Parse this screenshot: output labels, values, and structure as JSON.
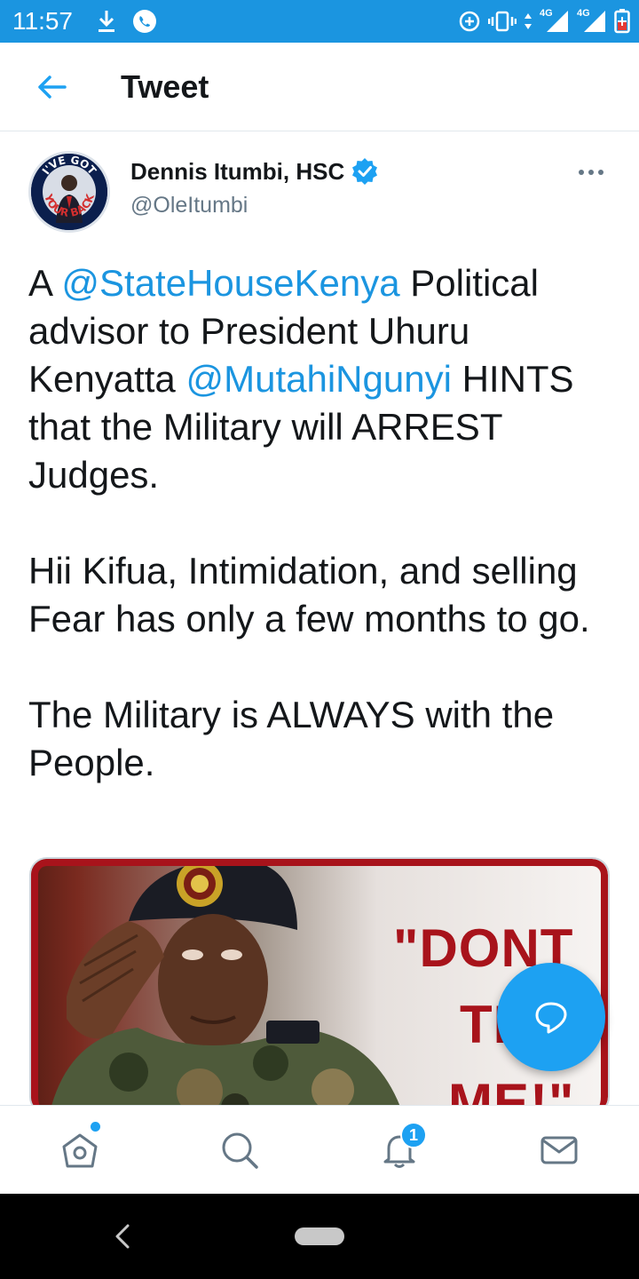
{
  "status_bar": {
    "time": "11:57",
    "network_label_1": "4G",
    "network_label_2": "4G",
    "icons": [
      "download-icon",
      "whatsapp-icon",
      "data-saver-icon",
      "vibrate-icon",
      "signal-4g-icon",
      "signal-4g-icon",
      "battery-icon"
    ]
  },
  "header": {
    "title": "Tweet",
    "back_icon": "arrow-left-icon"
  },
  "tweet": {
    "author_name": "Dennis Itumbi, HSC",
    "author_handle": "@OleItumbi",
    "avatar_text": [
      "I'VE GOT",
      "YOUR BACK"
    ],
    "text": {
      "p1_a": "A ",
      "p1_mention1": "@StateHouseKenya",
      "p1_b": " Political advisor to President Uhuru Kenyatta ",
      "p1_mention2": "@MutahiNgunyi",
      "p1_c": " HINTS that the Military will ARREST Judges.",
      "p2": "Hii Kifua, Intimidation, and selling Fear has only a few months to go.",
      "p3": "The Military is ALWAYS with the People."
    },
    "media": {
      "quote_line1": "\"DONT",
      "quote_line2": "TE",
      "quote_line3": "ME!\""
    }
  },
  "bottom_nav": {
    "items": [
      "home-icon",
      "search-icon",
      "notifications-icon",
      "messages-icon"
    ],
    "notification_badge": "1"
  },
  "colors": {
    "status_bar": "#1b95e0",
    "accent": "#1da1f2",
    "mention": "#1b95e0",
    "poster_red": "#a8131b"
  }
}
